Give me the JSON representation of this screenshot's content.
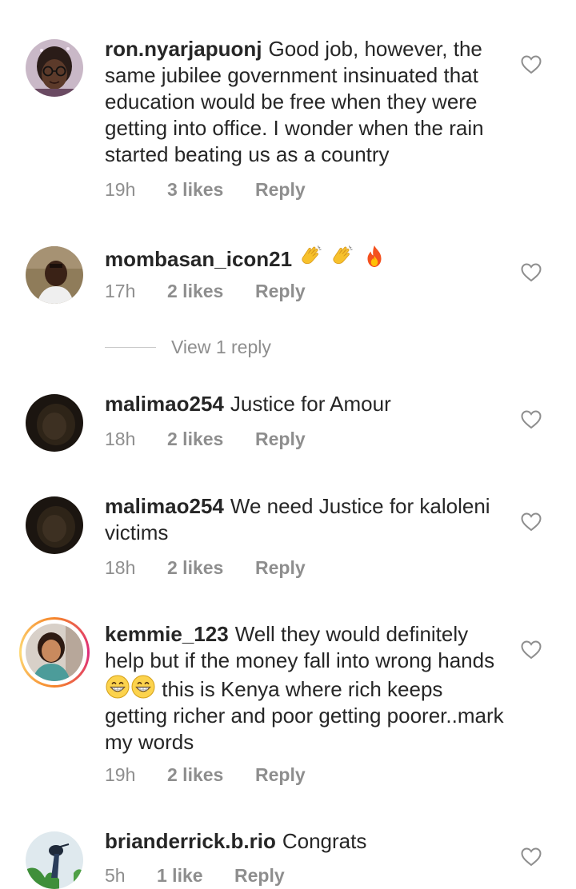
{
  "comments": [
    {
      "username": "ron.nyarjapuonj",
      "text": "Good job, however, the same jubilee government insinuated that education would be free when they were getting into office. I wonder when the rain started beating us as a country",
      "time": "19h",
      "likes": "3 likes",
      "reply": "Reply",
      "avatar": "avatar-woman-glasses"
    },
    {
      "username": "mombasan_icon21",
      "text": "",
      "emojis": [
        "clapping-hands",
        "clapping-hands",
        "fire"
      ],
      "time": "17h",
      "likes": "2 likes",
      "reply": "Reply",
      "view_replies": "View 1 reply",
      "avatar": "avatar-man-outdoors"
    },
    {
      "username": "malimao254",
      "text": "Justice for Amour",
      "time": "18h",
      "likes": "2 likes",
      "reply": "Reply",
      "avatar": "avatar-dark"
    },
    {
      "username": "malimao254",
      "text": "We need Justice for kaloleni victims",
      "time": "18h",
      "likes": "2 likes",
      "reply": "Reply",
      "avatar": "avatar-dark"
    },
    {
      "username": "kemmie_123",
      "text_before": "Well they would definitely help but if the money fall into wrong hands",
      "emojis": [
        "grinning-face",
        "grinning-face"
      ],
      "text_after": "this is Kenya where rich keeps getting richer and poor getting poorer..mark my words",
      "time": "19h",
      "likes": "2 likes",
      "reply": "Reply",
      "avatar": "avatar-woman-story-ring"
    },
    {
      "username": "brianderrick.b.rio",
      "text": "Congrats",
      "time": "5h",
      "likes": "1 like",
      "reply": "Reply",
      "avatar": "avatar-bird-green"
    }
  ],
  "colors": {
    "text": "#262626",
    "meta": "#8e8e8e",
    "story_ring_start": "#f58529",
    "story_ring_end": "#dd2a7b"
  }
}
